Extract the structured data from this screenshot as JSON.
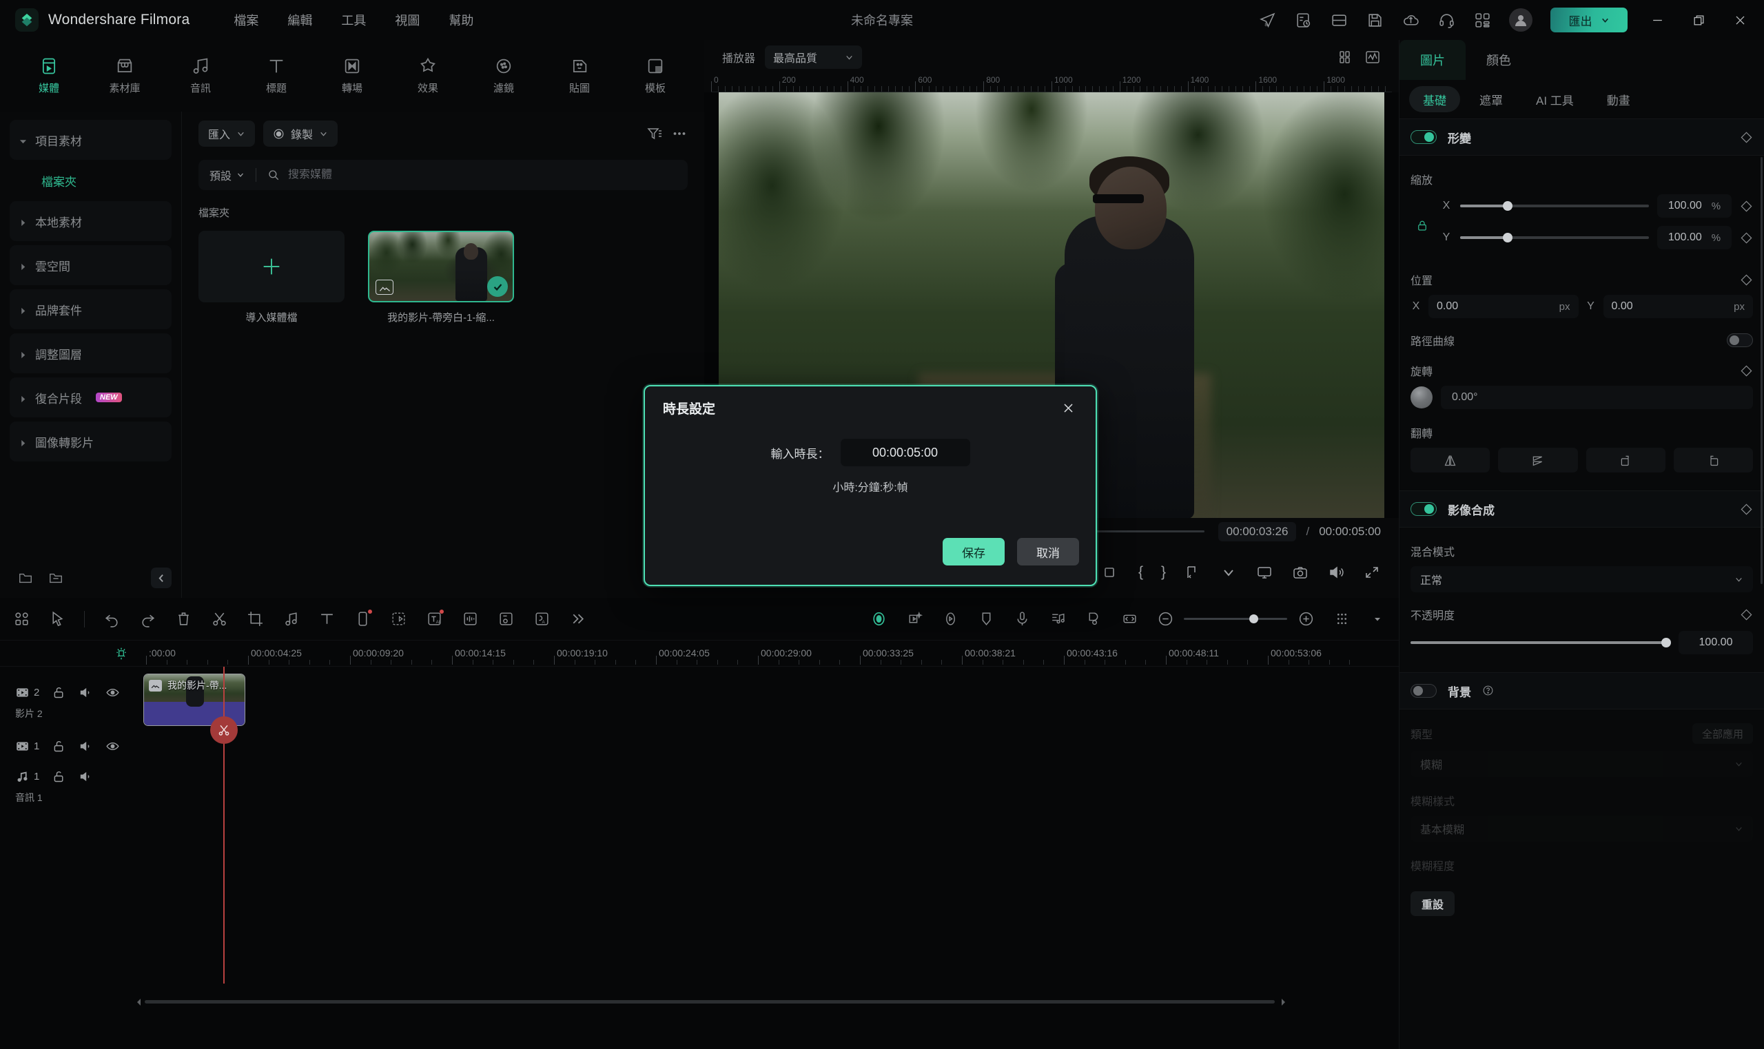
{
  "titlebar": {
    "brand": "Wondershare Filmora",
    "menus": [
      "檔案",
      "編輯",
      "工具",
      "視圖",
      "幫助"
    ],
    "project_title": "未命名專案",
    "icons": [
      "share-icon",
      "history-icon",
      "layout-icon",
      "save-icon",
      "cloud-upload-icon",
      "headset-support-icon",
      "apps-grid-icon"
    ],
    "export_label": "匯出",
    "window_buttons": [
      "minimize-icon",
      "restore-icon",
      "close-icon"
    ],
    "accent_color": "#35c49c"
  },
  "nav_tabs": [
    {
      "label": "媒體",
      "icon": "media-icon",
      "active": true
    },
    {
      "label": "素材庫",
      "icon": "stock-library-icon",
      "active": false
    },
    {
      "label": "音訊",
      "icon": "audio-note-icon",
      "active": false
    },
    {
      "label": "標題",
      "icon": "title-text-icon",
      "active": false
    },
    {
      "label": "轉場",
      "icon": "transition-icon",
      "active": false
    },
    {
      "label": "效果",
      "icon": "effects-icon",
      "active": false
    },
    {
      "label": "濾鏡",
      "icon": "filter-icon",
      "active": false
    },
    {
      "label": "貼圖",
      "icon": "sticker-icon",
      "active": false
    },
    {
      "label": "模板",
      "icon": "template-icon",
      "active": false
    }
  ],
  "left_tree": [
    {
      "label": "項目素材",
      "expanded": true,
      "selected": false,
      "sub": false,
      "badge": ""
    },
    {
      "label": "檔案夾",
      "expanded": false,
      "selected": true,
      "sub": true,
      "badge": ""
    },
    {
      "label": "本地素材",
      "expanded": false,
      "selected": false,
      "sub": false,
      "badge": ""
    },
    {
      "label": "雲空間",
      "expanded": false,
      "selected": false,
      "sub": false,
      "badge": ""
    },
    {
      "label": "品牌套件",
      "expanded": false,
      "selected": false,
      "sub": false,
      "badge": ""
    },
    {
      "label": "調整圖層",
      "expanded": false,
      "selected": false,
      "sub": false,
      "badge": ""
    },
    {
      "label": "復合片段",
      "expanded": false,
      "selected": false,
      "sub": false,
      "badge": "NEW"
    },
    {
      "label": "圖像轉影片",
      "expanded": false,
      "selected": false,
      "sub": false,
      "badge": ""
    }
  ],
  "browser": {
    "import_label": "匯入",
    "record_label": "錄製",
    "preset_label": "預設",
    "search_placeholder": "搜索媒體",
    "search_value": "",
    "filter_icon": "filter-list-icon",
    "more_icon": "more-horizontal-icon",
    "folder_label": "檔案夾",
    "items": [
      {
        "type": "add",
        "name": "導入媒體檔",
        "selected": false
      },
      {
        "type": "media",
        "name": "我的影片-帶旁白-1-縮...",
        "selected": true
      }
    ]
  },
  "player": {
    "label": "播放器",
    "quality": "最高品質",
    "view_icons": [
      "split-view-icon",
      "waveform-monitor-icon"
    ],
    "ruler_ticks": [
      "0",
      "200",
      "400",
      "600",
      "800",
      "1000",
      "1200",
      "1400",
      "1600",
      "1800"
    ],
    "current_time": "00:00:03:26",
    "separator": "/",
    "total_time": "00:00:05:00",
    "controls": [
      "prev-frame-icon",
      "play-icon",
      "next-frame-icon",
      "stop-icon",
      "mark-in-icon",
      "mark-out-icon"
    ],
    "right_controls": [
      "brace-open",
      "brace-close",
      "aspect-ratio-icon",
      "chevron-down-icon",
      "display-settings-icon",
      "snapshot-camera-icon",
      "volume-icon",
      "fullscreen-icon"
    ]
  },
  "properties": {
    "tabs": [
      {
        "label": "圖片",
        "active": true
      },
      {
        "label": "顏色",
        "active": false
      }
    ],
    "subtabs": [
      {
        "label": "基礎",
        "active": true
      },
      {
        "label": "遮罩",
        "active": false
      },
      {
        "label": "AI 工具",
        "active": false
      },
      {
        "label": "動畫",
        "active": false
      }
    ],
    "transform": {
      "section_title": "形變",
      "enabled": true,
      "scale_label": "縮放",
      "scale_x_axis": "X",
      "scale_x_value": "100.00",
      "scale_x_unit": "%",
      "scale_y_axis": "Y",
      "scale_y_value": "100.00",
      "scale_y_unit": "%",
      "lock_icon": "link-lock-icon",
      "position_label": "位置",
      "pos_x_axis": "X",
      "pos_x_value": "0.00",
      "pos_x_unit": "px",
      "pos_y_axis": "Y",
      "pos_y_value": "0.00",
      "pos_y_unit": "px",
      "path_curve_label": "路徑曲線",
      "path_curve_enabled": false,
      "rotate_label": "旋轉",
      "rotate_value": "0.00°",
      "flip_label": "翻轉",
      "flip_buttons": [
        "flip-horizontal-icon",
        "flip-vertical-icon",
        "rotate-cw-icon",
        "rotate-ccw-icon"
      ]
    },
    "compositing": {
      "section_title": "影像合成",
      "enabled": true,
      "blend_label": "混合模式",
      "blend_value": "正常",
      "opacity_label": "不透明度",
      "opacity_value": "100.00"
    },
    "background": {
      "section_title": "背景",
      "enabled": false,
      "help_icon": "help-circle-icon",
      "type_label": "類型",
      "apply_all_label": "全部應用",
      "type_value": "模糊",
      "blur_style_label": "模糊樣式",
      "blur_style_value": "基本模糊",
      "blur_amount_label": "模糊程度"
    },
    "reset_label": "重設"
  },
  "timeline": {
    "toolbar_icons": [
      "grid-view-icon",
      "select-tool-icon",
      "undo-icon",
      "redo-icon",
      "delete-icon",
      "split-scissors-icon",
      "crop-icon",
      "audio-detach-icon",
      "text-tool-icon",
      "mask-tool-icon",
      "keyframe-tool-icon",
      "ai-text-icon",
      "audio-waveform-icon",
      "speed-ramp-icon",
      "auto-sync-icon",
      "more-chevrons-icon"
    ],
    "right_icons": [
      "ai-assistant-icon",
      "ai-effects-icon",
      "render-preview-icon",
      "marker-icon",
      "voiceover-mic-icon",
      "beat-detect-icon",
      "auto-reframe-icon",
      "fit-timeline-icon"
    ],
    "zoom_out_icon": "zoom-out-icon",
    "zoom_in_icon": "zoom-in-icon",
    "grid_toggle_icon": "timeline-grid-icon",
    "ruler_marks": [
      ":00:00",
      "00:00:04:25",
      "00:00:09:20",
      "00:00:14:15",
      "00:00:19:10",
      "00:00:24:05",
      "00:00:29:00",
      "00:00:33:25",
      "00:00:38:21",
      "00:00:43:16",
      "00:00:48:11",
      "00:00:53:06"
    ],
    "magnet_icon": "magnet-snap-icon",
    "tracks": [
      {
        "kind": "video",
        "number": "2",
        "name": "影片 2",
        "icons": [
          "video-track-icon",
          "unlock-icon",
          "mute-icon",
          "eye-visible-icon"
        ],
        "clip": {
          "label": "我的影片-帶...",
          "badge_icon": "image-clip-icon"
        }
      },
      {
        "kind": "video",
        "number": "1",
        "name": "",
        "icons": [
          "video-track-icon",
          "unlock-icon",
          "mute-icon",
          "eye-visible-icon"
        ],
        "clip": null
      },
      {
        "kind": "audio",
        "number": "1",
        "name": "音訊 1",
        "icons": [
          "audio-track-icon",
          "unlock-icon",
          "mute-icon"
        ],
        "clip": null
      }
    ],
    "playhead_icon": "playhead-split-icon"
  },
  "modal": {
    "title": "時長設定",
    "close_icon": "close-icon",
    "field_label": "輸入時長：",
    "duration_value": "00:00:05:00",
    "hint": "小時:分鐘:秒:幀",
    "save_label": "保存",
    "cancel_label": "取消",
    "border_color": "#4ee0b4"
  }
}
